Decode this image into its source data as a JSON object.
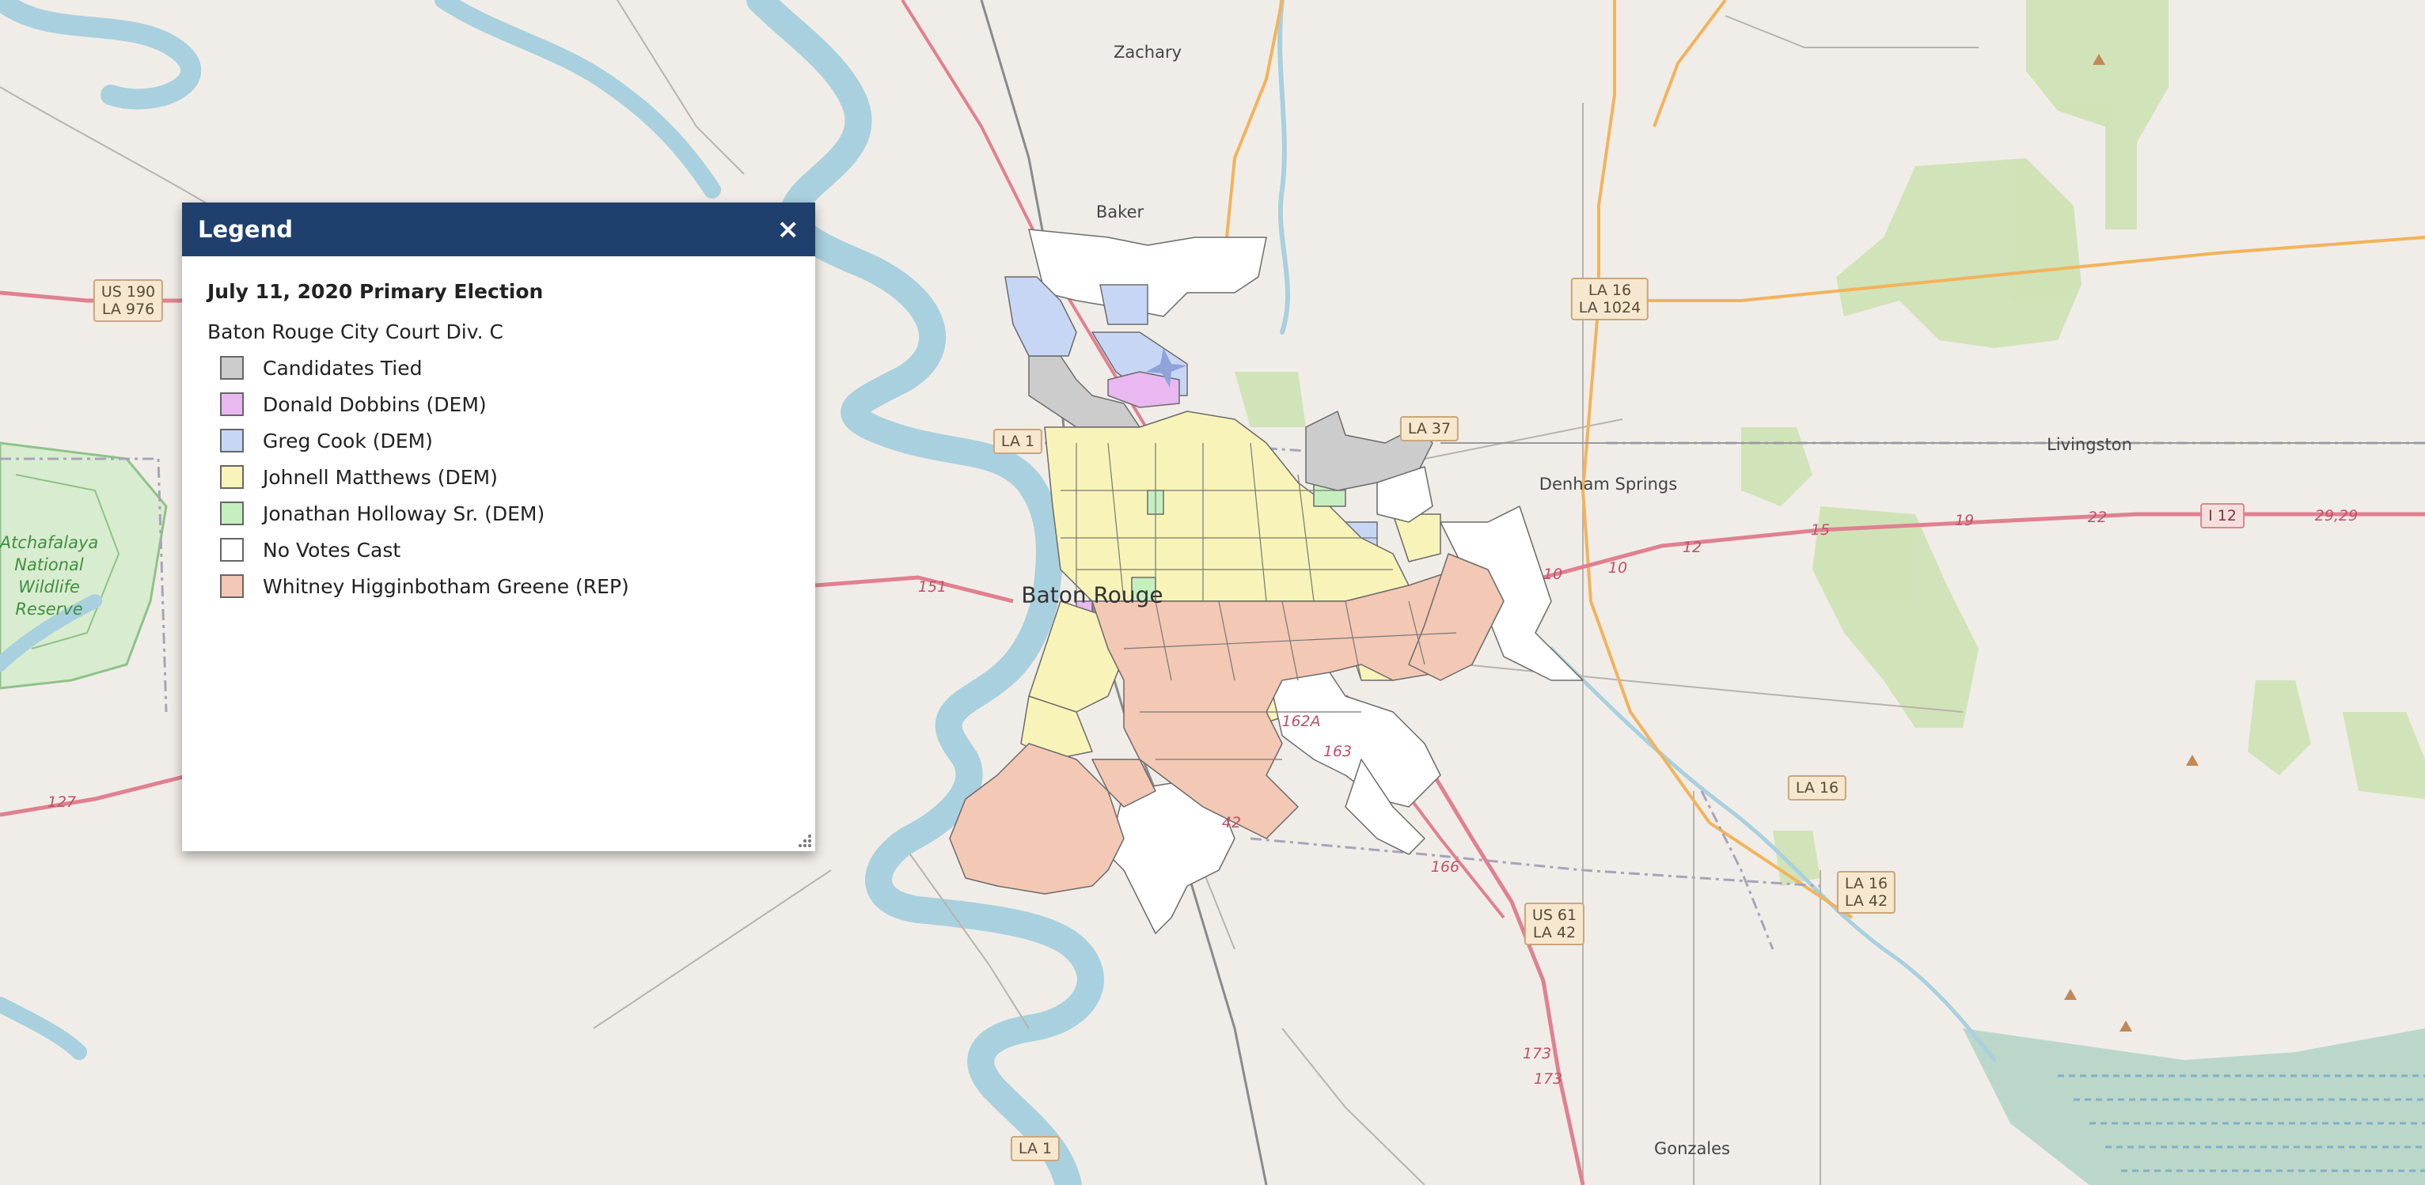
{
  "map": {
    "places": [
      {
        "id": "zachary",
        "name": "Zachary"
      },
      {
        "id": "baker",
        "name": "Baker"
      },
      {
        "id": "baton-rouge",
        "name": "Baton Rouge"
      },
      {
        "id": "denham-springs",
        "name": "Denham Springs"
      },
      {
        "id": "livingston",
        "name": "Livingston"
      },
      {
        "id": "gonzales",
        "name": "Gonzales"
      },
      {
        "id": "atchafalaya",
        "name": "Atchafalaya National Wildlife Reserve"
      }
    ],
    "shields": [
      {
        "id": "us190-la976",
        "line1": "US 190",
        "line2": "LA 976"
      },
      {
        "id": "la16-la1024",
        "line1": "LA 16",
        "line2": "LA 1024"
      },
      {
        "id": "la37",
        "line1": "LA 37"
      },
      {
        "id": "la1-north",
        "line1": "LA 1"
      },
      {
        "id": "la1-south",
        "line1": "LA 1"
      },
      {
        "id": "la16-east",
        "line1": "LA 16"
      },
      {
        "id": "us61-la42",
        "line1": "US 61",
        "line2": "LA 42"
      },
      {
        "id": "la16-la42",
        "line1": "LA 16",
        "line2": "LA 42"
      },
      {
        "id": "i12",
        "line1": "I 12"
      }
    ],
    "route_numbers": [
      {
        "id": "r127",
        "text": "127"
      },
      {
        "id": "r151",
        "text": "151"
      },
      {
        "id": "r10a",
        "text": "10"
      },
      {
        "id": "r10b",
        "text": "10"
      },
      {
        "id": "r12",
        "text": "12"
      },
      {
        "id": "r15",
        "text": "15"
      },
      {
        "id": "r19",
        "text": "19"
      },
      {
        "id": "r22",
        "text": "22"
      },
      {
        "id": "r2929",
        "text": "29,29"
      },
      {
        "id": "r166",
        "text": "166"
      },
      {
        "id": "r173a",
        "text": "173"
      },
      {
        "id": "r173b",
        "text": "173"
      },
      {
        "id": "r42",
        "text": "42"
      },
      {
        "id": "r162a",
        "text": "162A"
      },
      {
        "id": "r163",
        "text": "163"
      }
    ],
    "colors": {
      "tied": "#cccccc",
      "dobbins": "#e9b8f0",
      "cook": "#c8d6f5",
      "matthews": "#f8f3b8",
      "holloway": "#c6efc0",
      "none": "#ffffff",
      "greene": "#f3c8b4"
    }
  },
  "legend": {
    "title": "Legend",
    "close_label": "×",
    "subtitle": "July 11, 2020 Primary Election",
    "race": "Baton Rouge City Court Div. C",
    "items": [
      {
        "label": "Candidates Tied",
        "color": "#cccccc"
      },
      {
        "label": "Donald Dobbins (DEM)",
        "color": "#e9b8f0"
      },
      {
        "label": "Greg Cook (DEM)",
        "color": "#c8d6f5"
      },
      {
        "label": "Johnell Matthews (DEM)",
        "color": "#f8f3b8"
      },
      {
        "label": "Jonathan Holloway Sr. (DEM)",
        "color": "#c6efc0"
      },
      {
        "label": "No Votes Cast",
        "color": "#ffffff"
      },
      {
        "label": "Whitney Higginbotham Greene (REP)",
        "color": "#f3c8b4"
      }
    ]
  }
}
